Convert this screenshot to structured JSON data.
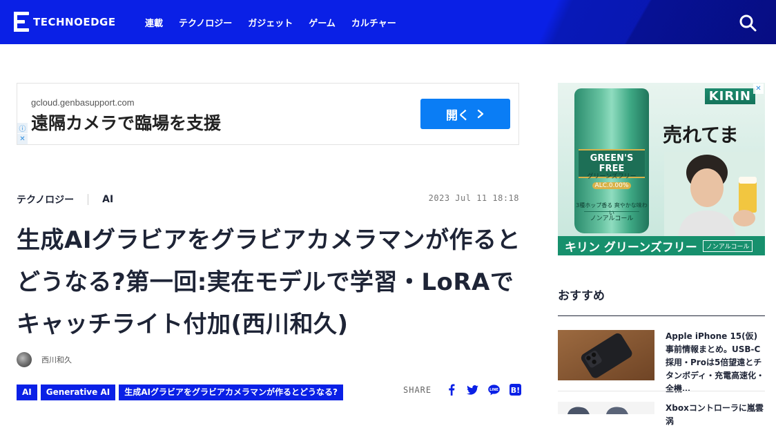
{
  "header": {
    "logo_text": "TECHNOEDGE",
    "nav": [
      "連載",
      "テクノロジー",
      "ガジェット",
      "ゲーム",
      "カルチャー"
    ]
  },
  "ad_banner": {
    "domain": "gcloud.genbasupport.com",
    "headline": "遠隔カメラで臨場を支援",
    "button": "開く"
  },
  "article": {
    "category": "テクノロジー",
    "subcategory": "AI",
    "date": "2023 Jul 11 18:18",
    "title": "生成AIグラビアをグラビアカメラマンが作るとどうなる?第一回:実在モデルで学習・LoRAでキャッチライト付加(西川和久)",
    "author": "西川和久",
    "tags": [
      "AI",
      "Generative AI",
      "生成AIグラビアをグラビアカメラマンが作るとどうなる?"
    ],
    "share_label": "SHARE"
  },
  "side_ad": {
    "brand": "KIRIN",
    "catch": "売れてます!",
    "can_name": "GREEN'S FREE",
    "can_kana": "グリーンズフリー",
    "can_alc": "ALC.0.00%",
    "can_note": "3種ホップ香る 爽やかな味わい",
    "can_nonal": "ノンアルコール",
    "bar_text": "キリン グリーンズフリー",
    "bar_badge": "ノンアルコール"
  },
  "recommend": {
    "title": "おすすめ",
    "items": [
      {
        "text": "Apple iPhone 15(仮) 事前情報まとめ。USB-C採用・Proは5倍望遠とチタンボディ・充電高速化・全機…"
      },
      {
        "text": "Xboxコントローラに嵐雲涡"
      }
    ]
  },
  "colors": {
    "brand_blue": "#0a20e6",
    "button_blue": "#0a7df5",
    "kirin_green": "#17906d"
  }
}
